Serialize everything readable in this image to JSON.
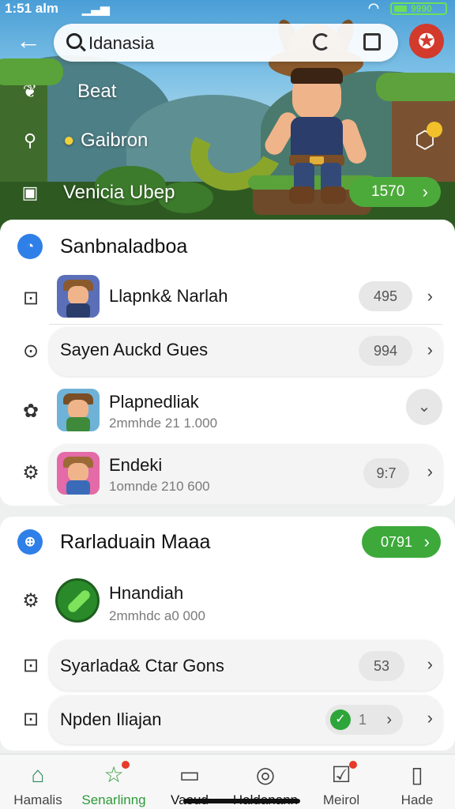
{
  "status_bar": {
    "time": "1:51 alm",
    "signal": "▁▃▅",
    "battery": "9990"
  },
  "search": {
    "value": "Idanasia"
  },
  "hero": {
    "items": [
      {
        "label": "Beat",
        "icon": "bird-icon"
      },
      {
        "label": "Gaibron",
        "icon": "search-icon"
      },
      {
        "label": "Venicia Ubep",
        "icon": "briefcase-icon"
      }
    ],
    "cta": {
      "label": "1570"
    }
  },
  "section1": {
    "title": "Sanbnaladboa",
    "rows": [
      {
        "title": "Llapnk& Narlah",
        "count": "495"
      },
      {
        "title": "Sayen Auckd Gues",
        "count": "994"
      },
      {
        "title": "Plapnedliak",
        "subtitle": "2mmhde 21 1.000"
      },
      {
        "title": "Endeki",
        "subtitle": "1omnde 210 600",
        "count": "9:7"
      }
    ]
  },
  "section2": {
    "title": "Rarladuain Maaa",
    "cta": "0791",
    "rows": [
      {
        "title": "Hnandiah",
        "subtitle": "2mmhdc a0 000"
      },
      {
        "title": "Syarlada& Ctar Gons",
        "count": "53"
      },
      {
        "title": "Npden Iliajan",
        "count": "1"
      }
    ]
  },
  "bottom_nav": [
    {
      "label": "Hamalis",
      "icon": "home-icon"
    },
    {
      "label": "Senarlinng",
      "icon": "star-icon"
    },
    {
      "label": "Vaoud",
      "icon": "card-icon"
    },
    {
      "label": "Haldanann",
      "icon": "compass-icon"
    },
    {
      "label": "Meirol",
      "icon": "inbox-icon"
    },
    {
      "label": "Hade",
      "icon": "phone-icon"
    }
  ],
  "colors": {
    "accent_green": "#3ca93a",
    "accent_blue": "#2f7fe8",
    "badge_red": "#d23a2c"
  }
}
